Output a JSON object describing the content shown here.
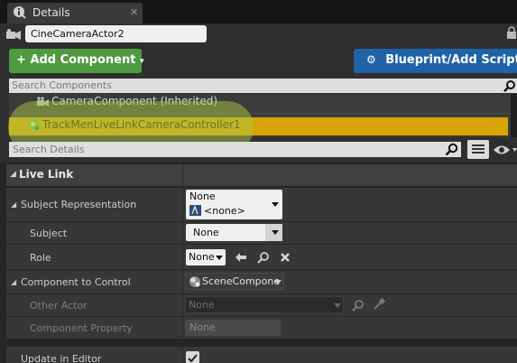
{
  "tab": {
    "label": "Details",
    "icon": "details-info-icon",
    "close": "✕"
  },
  "actor": {
    "name": "CineCameraActor2",
    "icon": "actor-icon"
  },
  "toolbar": {
    "add_component_label": "Add Component",
    "add_component_plus": "+",
    "blueprint_label": "Blueprint/Add Script"
  },
  "component_search": {
    "placeholder": "Search Components"
  },
  "components": [
    {
      "label": "CameraComponent (Inherited)",
      "icon": "camera-icon"
    },
    {
      "label": "TrackMenLiveLinkCameraController1",
      "icon": "livelink-component-icon",
      "selected": true
    }
  ],
  "details_search": {
    "placeholder": "Search Details"
  },
  "category": {
    "label": "Live Link"
  },
  "properties": {
    "subject_representation": {
      "label": "Subject Representation",
      "line1": "None",
      "line2": "<none>"
    },
    "subject": {
      "label": "Subject",
      "value": "None"
    },
    "role": {
      "label": "Role",
      "value": "None"
    },
    "component_to_control": {
      "label": "Component to Control",
      "value": "SceneCompone"
    },
    "other_actor": {
      "label": "Other Actor",
      "value": "None"
    },
    "component_property": {
      "label": "Component Property",
      "value": "None"
    },
    "update_in_editor": {
      "label": "Update in Editor",
      "checked": true
    }
  },
  "colors": {
    "add_button": "#4f9a3f",
    "blueprint_button": "#2062a6",
    "selected_row": "#d9a406",
    "highlight_annotation": "#aac846"
  }
}
